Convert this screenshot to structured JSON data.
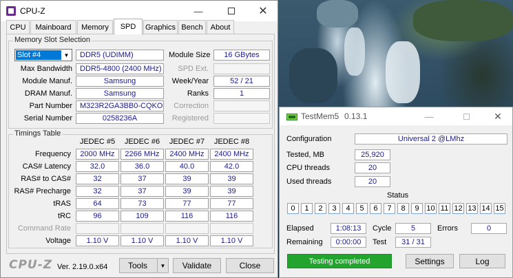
{
  "cpuz": {
    "title": "CPU-Z",
    "tabs": [
      "CPU",
      "Mainboard",
      "Memory",
      "SPD",
      "Graphics",
      "Bench",
      "About"
    ],
    "active_tab": "SPD",
    "slot_group": {
      "title": "Memory Slot Selection",
      "slot": "Slot #4",
      "type": "DDR5 (UDIMM)",
      "module_size_label": "Module Size",
      "module_size": "16 GBytes",
      "max_bw_label": "Max Bandwidth",
      "max_bw": "DDR5-4800 (2400 MHz)",
      "spd_ext_label": "SPD Ext.",
      "manuf_label": "Module Manuf.",
      "manuf": "Samsung",
      "week_label": "Week/Year",
      "week": "52 / 21",
      "dram_label": "DRAM Manuf.",
      "dram": "Samsung",
      "ranks_label": "Ranks",
      "ranks": "1",
      "part_label": "Part Number",
      "part": "M323R2GA3BB0-CQKOL",
      "correction_label": "Correction",
      "serial_label": "Serial Number",
      "serial": "0258236A",
      "registered_label": "Registered"
    },
    "timings": {
      "title": "Timings Table",
      "columns": [
        "JEDEC #5",
        "JEDEC #6",
        "JEDEC #7",
        "JEDEC #8"
      ],
      "rows": [
        {
          "label": "Frequency",
          "values": [
            "2000 MHz",
            "2266 MHz",
            "2400 MHz",
            "2400 MHz"
          ]
        },
        {
          "label": "CAS# Latency",
          "values": [
            "32.0",
            "36.0",
            "40.0",
            "42.0"
          ]
        },
        {
          "label": "RAS# to CAS#",
          "values": [
            "32",
            "37",
            "39",
            "39"
          ]
        },
        {
          "label": "RAS# Precharge",
          "values": [
            "32",
            "37",
            "39",
            "39"
          ]
        },
        {
          "label": "tRAS",
          "values": [
            "64",
            "73",
            "77",
            "77"
          ]
        },
        {
          "label": "tRC",
          "values": [
            "96",
            "109",
            "116",
            "116"
          ]
        },
        {
          "label": "Command Rate",
          "values": [
            "",
            "",
            "",
            ""
          ]
        },
        {
          "label": "Voltage",
          "values": [
            "1.10 V",
            "1.10 V",
            "1.10 V",
            "1.10 V"
          ]
        }
      ]
    },
    "footer": {
      "brand": "CPU-Z",
      "version": "Ver. 2.19.0.x64",
      "tools": "Tools",
      "validate": "Validate",
      "close": "Close"
    }
  },
  "testmem": {
    "title": "TestMem5",
    "version": "0.13.1",
    "configuration_label": "Configuration",
    "configuration": "Universal 2 @LMhz",
    "tested_label": "Tested, MB",
    "tested": "25,920",
    "cpu_threads_label": "CPU threads",
    "cpu_threads": "20",
    "used_threads_label": "Used threads",
    "used_threads": "20",
    "status_label": "Status",
    "status_cells": [
      "0",
      "1",
      "2",
      "3",
      "4",
      "5",
      "6",
      "7",
      "8",
      "9",
      "10",
      "11",
      "12",
      "13",
      "14",
      "15"
    ],
    "elapsed_label": "Elapsed",
    "elapsed": "1:08:13",
    "cycle_label": "Cycle",
    "cycle": "5",
    "errors_label": "Errors",
    "errors": "0",
    "remaining_label": "Remaining",
    "remaining": "0:00:00",
    "test_label": "Test",
    "test": "31 / 31",
    "progress_text": "Testing completed",
    "progress_color": "#22a42e",
    "settings": "Settings",
    "log": "Log"
  }
}
